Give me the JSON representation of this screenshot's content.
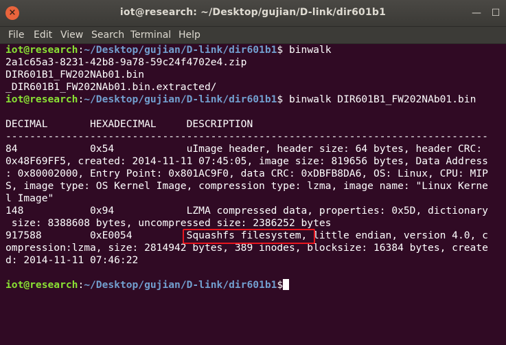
{
  "window": {
    "title": "iot@research: ~/Desktop/gujian/D-link/dir601b1",
    "close_glyph": "×",
    "minimize_glyph": "—",
    "maximize_glyph": "☐"
  },
  "menu": {
    "file": "File",
    "edit": "Edit",
    "view": "View",
    "search": "Search",
    "terminal": "Terminal",
    "help": "Help"
  },
  "prompt": {
    "user": "iot@research",
    "sep": ":",
    "path": "~/Desktop/gujian/D-link/dir601b1",
    "symbol": "$"
  },
  "terminal": {
    "cmd1": " binwalk",
    "ls1": "2a1c65a3-8231-42b8-9a78-59c24f4702e4.zip",
    "ls2": "DIR601B1_FW202NAb01.bin",
    "ls3": "_DIR601B1_FW202NAb01.bin.extracted/",
    "cmd2": " binwalk DIR601B1_FW202NAb01.bin",
    "header": "DECIMAL       HEXADECIMAL     DESCRIPTION",
    "rule": "--------------------------------------------------------------------------------",
    "r1": "84            0x54            uImage header, header size: 64 bytes, header CRC:",
    "r2": "0x48F69FF5, created: 2014-11-11 07:45:05, image size: 819656 bytes, Data Address",
    "r3": ": 0x80002000, Entry Point: 0x801AC9F0, data CRC: 0xDBFB8DA6, OS: Linux, CPU: MIP",
    "r4": "S, image type: OS Kernel Image, compression type: lzma, image name: \"Linux Kerne",
    "r5": "l Image\"",
    "r6": "148           0x94            LZMA compressed data, properties: 0x5D, dictionary",
    "r7": " size: 8388608 bytes, uncompressed size: 2386252 bytes",
    "r8": "917588        0xE0054         Squashfs filesystem, little endian, version 4.0, c",
    "r9": "ompression:lzma, size: 2814942 bytes, 389 inodes, blocksize: 16384 bytes, create",
    "r10": "d: 2014-11-11 07:46:22"
  }
}
